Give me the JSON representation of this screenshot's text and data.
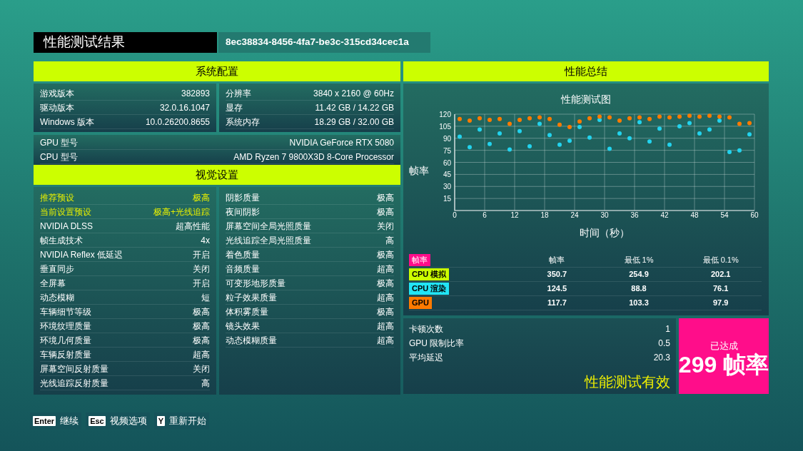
{
  "header": {
    "title": "性能测试结果",
    "run_id": "8ec38834-8456-4fa7-be3c-315cd34cec1a"
  },
  "system": {
    "heading": "系统配置",
    "left": [
      {
        "label": "游戏版本",
        "value": "382893"
      },
      {
        "label": "驱动版本",
        "value": "32.0.16.1047"
      },
      {
        "label": "Windows 版本",
        "value": "10.0.26200.8655"
      }
    ],
    "right": [
      {
        "label": "分辨率",
        "value": "3840 x 2160 @ 60Hz"
      },
      {
        "label": "显存",
        "value": "11.42 GB / 14.22 GB"
      },
      {
        "label": "系统内存",
        "value": "18.29 GB / 32.00 GB"
      }
    ],
    "hardware": [
      {
        "label": "GPU 型号",
        "value": "NVIDIA GeForce RTX 5080"
      },
      {
        "label": "CPU 型号",
        "value": "AMD Ryzen 7 9800X3D 8-Core Processor"
      }
    ]
  },
  "visual": {
    "heading": "视觉设置",
    "left": [
      {
        "label": "推荐预设",
        "value": "极高",
        "highlighted": true
      },
      {
        "label": "当前设置预设",
        "value": "极高+光线追踪",
        "highlighted": true
      },
      {
        "label": "NVIDIA DLSS",
        "value": "超高性能",
        "highlighted": false
      },
      {
        "label": "帧生成技术",
        "value": "4x",
        "highlighted": false
      },
      {
        "label": "NVIDIA Reflex 低延迟",
        "value": "开启",
        "highlighted": false
      },
      {
        "label": "垂直同步",
        "value": "关闭",
        "highlighted": false
      },
      {
        "label": "全屏幕",
        "value": "开启",
        "highlighted": false
      },
      {
        "label": "动态模糊",
        "value": "短",
        "highlighted": false
      },
      {
        "label": "车辆细节等级",
        "value": "极高",
        "highlighted": false
      },
      {
        "label": "环境纹理质量",
        "value": "极高",
        "highlighted": false
      },
      {
        "label": "环境几何质量",
        "value": "极高",
        "highlighted": false
      },
      {
        "label": "车辆反射质量",
        "value": "超高",
        "highlighted": false
      },
      {
        "label": "屏幕空间反射质量",
        "value": "关闭",
        "highlighted": false
      },
      {
        "label": "光线追踪反射质量",
        "value": "高",
        "highlighted": false
      }
    ],
    "right": [
      {
        "label": "阴影质量",
        "value": "极高",
        "highlighted": false
      },
      {
        "label": "夜间阴影",
        "value": "极高",
        "highlighted": false
      },
      {
        "label": "屏幕空间全局光照质量",
        "value": "关闭",
        "highlighted": false
      },
      {
        "label": "光线追踪全局光照质量",
        "value": "高",
        "highlighted": false
      },
      {
        "label": "着色质量",
        "value": "极高",
        "highlighted": false
      },
      {
        "label": "音频质量",
        "value": "超高",
        "highlighted": false
      },
      {
        "label": "可变形地形质量",
        "value": "极高",
        "highlighted": false
      },
      {
        "label": "粒子效果质量",
        "value": "超高",
        "highlighted": false
      },
      {
        "label": "体积雾质量",
        "value": "极高",
        "highlighted": false
      },
      {
        "label": "镜头效果",
        "value": "超高",
        "highlighted": false
      },
      {
        "label": "动态模糊质量",
        "value": "超高",
        "highlighted": false
      }
    ]
  },
  "performance": {
    "heading": "性能总结",
    "chart_data": {
      "type": "scatter",
      "title": "性能测试图",
      "xlabel": "时间（秒）",
      "ylabel": "帧率",
      "x": [
        1,
        3,
        5,
        7,
        9,
        11,
        13,
        15,
        17,
        19,
        21,
        23,
        25,
        27,
        29,
        31,
        33,
        35,
        37,
        39,
        41,
        43,
        45,
        47,
        49,
        51,
        53,
        55,
        57,
        59
      ],
      "series": [
        {
          "color": "#22d3ee",
          "values": [
            92,
            79,
            101,
            83,
            96,
            76,
            99,
            80,
            108,
            94,
            82,
            87,
            104,
            91,
            113,
            77,
            96,
            90,
            110,
            86,
            102,
            82,
            105,
            109,
            96,
            101,
            112,
            73,
            75,
            95
          ]
        },
        {
          "color": "#ff7a00",
          "values": [
            114,
            112,
            115,
            113,
            114,
            108,
            113,
            115,
            116,
            114,
            107,
            104,
            111,
            115,
            117,
            116,
            112,
            115,
            116,
            114,
            117,
            116,
            117,
            118,
            117,
            118,
            117,
            116,
            108,
            109
          ]
        }
      ],
      "xlim": [
        0,
        60
      ],
      "ylim": [
        0,
        120
      ],
      "grid": true,
      "xticks": [
        0,
        6,
        12,
        18,
        24,
        30,
        36,
        42,
        48,
        54,
        60
      ],
      "yticks": [
        15,
        30,
        45,
        60,
        75,
        90,
        105,
        120
      ]
    },
    "table": {
      "header": {
        "label": "帧率",
        "color": "#ff0d8a",
        "columns": [
          "帧率",
          "最低 1%",
          "最低 0.1%"
        ]
      },
      "rows": [
        {
          "label": "CPU 模拟",
          "color": "#ccff00",
          "values": [
            "350.7",
            "254.9",
            "202.1"
          ]
        },
        {
          "label": "CPU 渲染",
          "color": "#22e5f5",
          "values": [
            "124.5",
            "88.8",
            "76.1"
          ]
        },
        {
          "label": "GPU",
          "color": "#ff7a00",
          "values": [
            "117.7",
            "103.3",
            "97.9"
          ]
        }
      ]
    },
    "stats": [
      {
        "label": "卡顿次数",
        "value": "1"
      },
      {
        "label": "GPU 限制比率",
        "value": "0.5"
      },
      {
        "label": "平均延迟",
        "value": "20.3"
      }
    ],
    "verdict": "性能测试有效",
    "achievement": {
      "caption": "已达成",
      "value": "299 帧率"
    }
  },
  "footer": [
    {
      "key": "Enter",
      "label": "继续"
    },
    {
      "key": "Esc",
      "label": "视频选项"
    },
    {
      "key": "Y",
      "label": "重新开始"
    }
  ]
}
